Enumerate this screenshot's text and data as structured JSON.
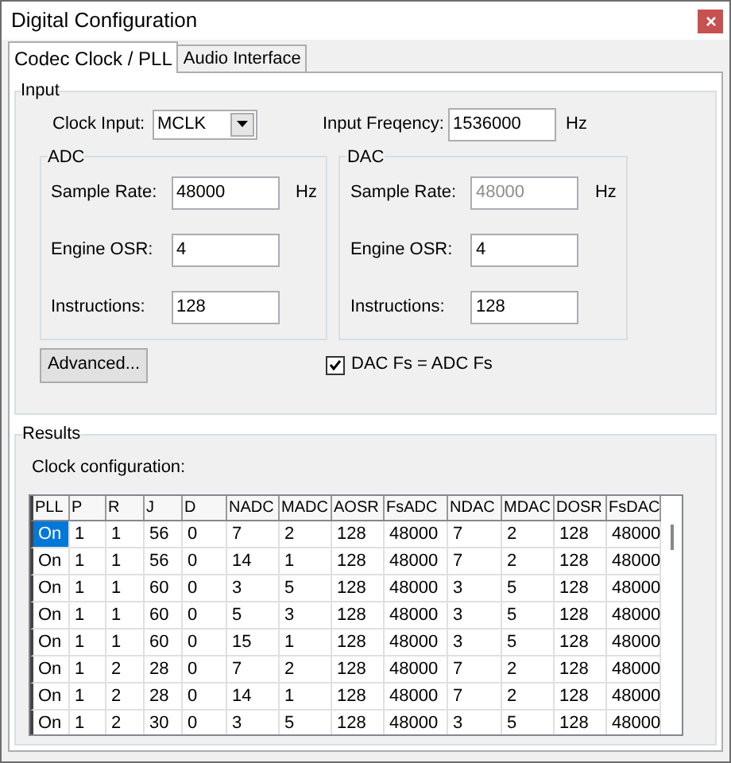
{
  "window": {
    "title": "Digital Configuration"
  },
  "tabs": [
    {
      "label": "Codec Clock / PLL",
      "selected": true
    },
    {
      "label": "Audio Interface",
      "selected": false
    }
  ],
  "input": {
    "title": "Input",
    "clock_input": {
      "label": "Clock Input:",
      "value": "MCLK"
    },
    "input_frequency": {
      "label": "Input Freqency:",
      "value": "1536000",
      "unit": "Hz"
    },
    "adc": {
      "title": "ADC",
      "sample_rate": {
        "label": "Sample Rate:",
        "value": "48000",
        "unit": "Hz",
        "disabled": false
      },
      "engine_osr": {
        "label": "Engine OSR:",
        "value": "4"
      },
      "instructions": {
        "label": "Instructions:",
        "value": "128"
      }
    },
    "dac": {
      "title": "DAC",
      "sample_rate": {
        "label": "Sample Rate:",
        "value": "48000",
        "unit": "Hz",
        "disabled": true
      },
      "engine_osr": {
        "label": "Engine OSR:",
        "value": "4"
      },
      "instructions": {
        "label": "Instructions:",
        "value": "128"
      }
    },
    "advanced_button": "Advanced...",
    "dac_fs_equals_adc_fs": {
      "label": "DAC Fs = ADC Fs",
      "checked": true
    }
  },
  "results": {
    "title": "Results",
    "subtitle": "Clock configuration:",
    "table": {
      "columns": [
        "PLL",
        "P",
        "R",
        "J",
        "D",
        "NADC",
        "MADC",
        "AOSR",
        "FsADC",
        "NDAC",
        "MDAC",
        "DOSR",
        "FsDAC"
      ],
      "rows": [
        {
          "selected": true,
          "cells": [
            "On",
            "1",
            "1",
            "56",
            "0",
            "7",
            "2",
            "128",
            "48000",
            "7",
            "2",
            "128",
            "48000"
          ]
        },
        {
          "selected": false,
          "cells": [
            "On",
            "1",
            "1",
            "56",
            "0",
            "14",
            "1",
            "128",
            "48000",
            "7",
            "2",
            "128",
            "48000"
          ]
        },
        {
          "selected": false,
          "cells": [
            "On",
            "1",
            "1",
            "60",
            "0",
            "3",
            "5",
            "128",
            "48000",
            "3",
            "5",
            "128",
            "48000"
          ]
        },
        {
          "selected": false,
          "cells": [
            "On",
            "1",
            "1",
            "60",
            "0",
            "5",
            "3",
            "128",
            "48000",
            "3",
            "5",
            "128",
            "48000"
          ]
        },
        {
          "selected": false,
          "cells": [
            "On",
            "1",
            "1",
            "60",
            "0",
            "15",
            "1",
            "128",
            "48000",
            "3",
            "5",
            "128",
            "48000"
          ]
        },
        {
          "selected": false,
          "cells": [
            "On",
            "1",
            "2",
            "28",
            "0",
            "7",
            "2",
            "128",
            "48000",
            "7",
            "2",
            "128",
            "48000"
          ]
        },
        {
          "selected": false,
          "cells": [
            "On",
            "1",
            "2",
            "28",
            "0",
            "14",
            "1",
            "128",
            "48000",
            "7",
            "2",
            "128",
            "48000"
          ]
        },
        {
          "selected": false,
          "cells": [
            "On",
            "1",
            "2",
            "30",
            "0",
            "3",
            "5",
            "128",
            "48000",
            "3",
            "5",
            "128",
            "48000"
          ]
        }
      ]
    }
  }
}
